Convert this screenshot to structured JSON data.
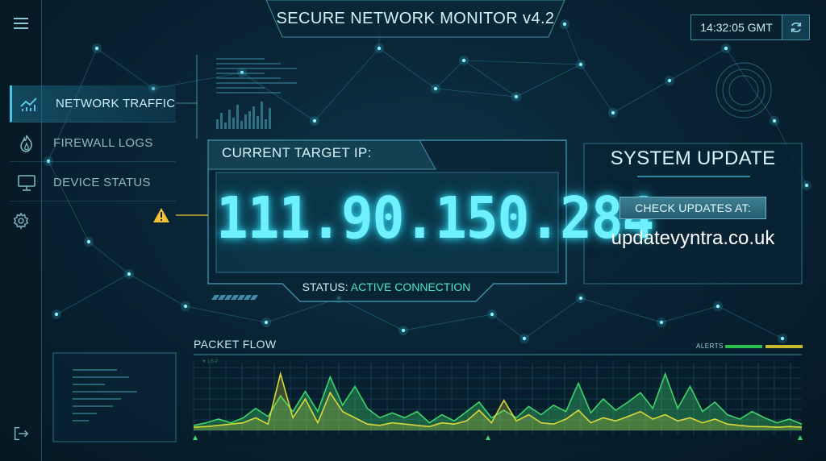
{
  "app": {
    "title": "SECURE NETWORK MONITOR v4.2",
    "clock": "14:32:05 GMT"
  },
  "icons": {
    "menu": "hamburger-icon",
    "refresh": "refresh-icon",
    "traffic": "chart-icon",
    "firewall": "flame-icon",
    "device": "monitor-icon",
    "settings": "gear-icon",
    "logout": "logout-icon",
    "warning": "warning-icon"
  },
  "nav": [
    {
      "label": "NETWORK TRAFFIC",
      "active": true
    },
    {
      "label": "FIREWALL LOGS",
      "active": false
    },
    {
      "label": "DEVICE STATUS",
      "active": false
    }
  ],
  "target": {
    "label": "CURRENT TARGET IP:",
    "ip": "111.90.150.284",
    "status_prefix": "STATUS:",
    "status_value": "ACTIVE CONNECTION"
  },
  "update": {
    "title": "SYSTEM UPDATE",
    "button": "CHECK UPDATES AT:",
    "domain": "updatevyntra.co.uk"
  },
  "packet_flow": {
    "title": "PACKET FLOW",
    "alerts_label": "ALERTS",
    "legend_label": "▼ LB.P",
    "green_series": [
      0.08,
      0.12,
      0.18,
      0.12,
      0.2,
      0.35,
      0.22,
      0.55,
      0.3,
      0.62,
      0.3,
      0.85,
      0.4,
      0.7,
      0.35,
      0.2,
      0.28,
      0.2,
      0.3,
      0.12,
      0.25,
      0.15,
      0.3,
      0.45,
      0.2,
      0.32,
      0.2,
      0.38,
      0.25,
      0.4,
      0.3,
      0.75,
      0.28,
      0.5,
      0.32,
      0.45,
      0.6,
      0.35,
      0.9,
      0.35,
      0.7,
      0.3,
      0.45,
      0.25,
      0.18,
      0.3,
      0.2,
      0.12,
      0.18,
      0.1
    ],
    "yellow_series": [
      0.05,
      0.06,
      0.08,
      0.1,
      0.12,
      0.2,
      0.1,
      0.9,
      0.2,
      0.5,
      0.12,
      0.6,
      0.3,
      0.2,
      0.1,
      0.08,
      0.12,
      0.1,
      0.08,
      0.06,
      0.12,
      0.1,
      0.15,
      0.32,
      0.12,
      0.48,
      0.15,
      0.25,
      0.12,
      0.1,
      0.18,
      0.32,
      0.12,
      0.2,
      0.15,
      0.22,
      0.3,
      0.18,
      0.25,
      0.15,
      0.2,
      0.12,
      0.18,
      0.1,
      0.08,
      0.06,
      0.06,
      0.05,
      0.06,
      0.05
    ],
    "colors": {
      "green": "#3ed46a",
      "yellow": "#d8d83a",
      "alert_green": "#27c24c",
      "alert_yellow": "#c9b92c"
    }
  },
  "colors": {
    "accent": "#45c8e6",
    "ip_glow": "#6ff0ff",
    "status_active": "#4de6c8",
    "warning": "#f2c230"
  }
}
